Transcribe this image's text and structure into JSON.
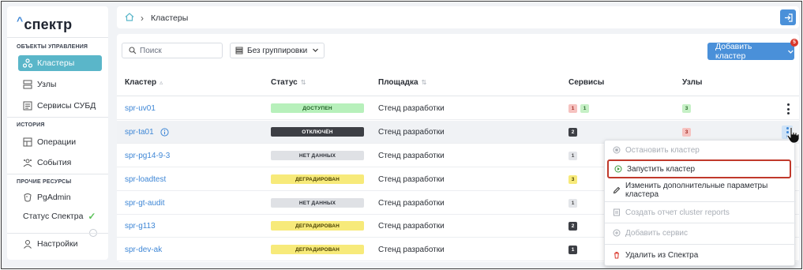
{
  "app": {
    "logo": "спектр"
  },
  "sidebar": {
    "sections": [
      {
        "title": "ОБЪЕКТЫ УПРАВЛЕНИЯ"
      },
      {
        "title": "ИСТОРИЯ"
      },
      {
        "title": "ПРОЧИЕ РЕСУРСЫ"
      }
    ],
    "items": [
      {
        "label": "Кластеры",
        "icon": "cluster-icon"
      },
      {
        "label": "Узлы",
        "icon": "server-icon"
      },
      {
        "label": "Сервисы СУБД",
        "icon": "database-icon"
      },
      {
        "label": "Операции",
        "icon": "operations-icon"
      },
      {
        "label": "События",
        "icon": "events-icon"
      },
      {
        "label": "PgAdmin",
        "icon": "pgadmin-icon"
      },
      {
        "label": "Статус Спектра",
        "icon": "check-icon"
      },
      {
        "label": "Настройки",
        "icon": "user-icon"
      }
    ]
  },
  "breadcrumb": {
    "current": "Кластеры"
  },
  "toolbar": {
    "search_placeholder": "Поиск",
    "grouping_label": "Без группировки",
    "add_button_label": "Добавить кластер",
    "notification_count": "5"
  },
  "table": {
    "headers": {
      "cluster": "Кластер",
      "status": "Статус",
      "site": "Площадка",
      "services": "Сервисы",
      "nodes": "Узлы"
    },
    "rows": [
      {
        "name": "spr-uv01",
        "status": "ДОСТУПЕН",
        "site": "Стенд разработки",
        "services": [
          "1",
          "1"
        ],
        "nodes": [
          "3"
        ]
      },
      {
        "name": "spr-ta01",
        "status": "ОТКЛЮЧЁН",
        "site": "Стенд разработки",
        "services": [
          "2"
        ],
        "nodes": [
          "3"
        ]
      },
      {
        "name": "spr-pg14-9-3",
        "status": "НЕТ ДАННЫХ",
        "site": "Стенд разработки",
        "services": [
          "1"
        ],
        "nodes": []
      },
      {
        "name": "spr-loadtest",
        "status": "ДЕГРАДИРОВАН",
        "site": "Стенд разработки",
        "services": [
          "3"
        ],
        "nodes": []
      },
      {
        "name": "spr-gt-audit",
        "status": "НЕТ ДАННЫХ",
        "site": "Стенд разработки",
        "services": [
          "1"
        ],
        "nodes": []
      },
      {
        "name": "spr-g113",
        "status": "ДЕГРАДИРОВАН",
        "site": "Стенд разработки",
        "services": [
          "2"
        ],
        "nodes": []
      },
      {
        "name": "spr-dev-ak",
        "status": "ДЕГРАДИРОВАН",
        "site": "Стенд разработки",
        "services": [
          "1"
        ],
        "nodes": []
      }
    ]
  },
  "context_menu": {
    "items": [
      {
        "label": "Остановить кластер",
        "enabled": false
      },
      {
        "label": "Запустить кластер",
        "enabled": true
      },
      {
        "label": "Изменить дополнительные параметры кластера",
        "enabled": true
      },
      {
        "label": "Создать отчет cluster reports",
        "enabled": false
      },
      {
        "label": "Добавить сервис",
        "enabled": false
      },
      {
        "label": "Удалить из Спектра",
        "enabled": true
      }
    ]
  },
  "colors": {
    "accent": "#4a90d9",
    "active_nav": "#5ab6c9",
    "highlight_border": "#c0392b",
    "delete_icon": "#d9372b"
  }
}
